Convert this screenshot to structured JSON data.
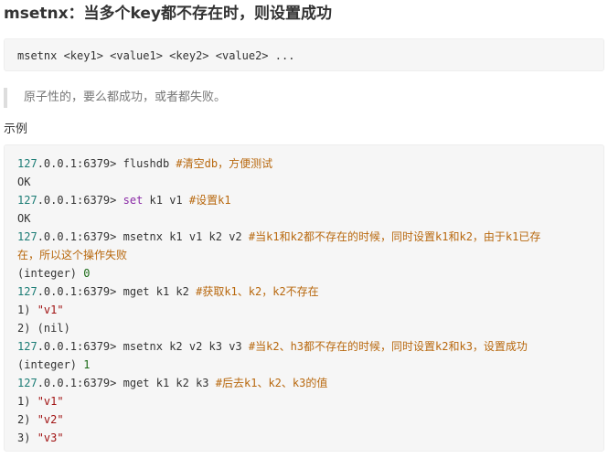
{
  "heading": "msetnx：当多个key都不存在时，则设置成功",
  "syntax": "msetnx <key1> <value1> <key2> <value2> ...",
  "note": "原子性的，要么都成功，或者都失败。",
  "example_label": "示例",
  "colors": {
    "prompt": "#1b7c75",
    "keyword": "#8a2aa6",
    "comment": "#b8680e",
    "string": "#a11313",
    "number": "#1a6a16",
    "code_background": "#f6f6f6"
  },
  "example": {
    "prompt_ip": "127",
    "prompt_rest": ".0.0.1:6379>",
    "lines": [
      {
        "type": "cmd",
        "cmd": " flushdb ",
        "comment": "#清空db，方便测试"
      },
      {
        "type": "out",
        "text": "OK"
      },
      {
        "type": "cmd",
        "kw": "set",
        "cmd": " k1 v1 ",
        "comment": "#设置k1"
      },
      {
        "type": "out",
        "text": "OK"
      },
      {
        "type": "cmd",
        "cmd": " msetnx k1 v1 k2 v2 ",
        "comment": "#当k1和k2都不存在的时候，同时设置k1和k2，由于k1已存"
      },
      {
        "type": "cont",
        "comment": "在，所以这个操作失败"
      },
      {
        "type": "out",
        "text": "(integer) ",
        "num": "0"
      },
      {
        "type": "cmd",
        "cmd": " mget k1 k2 ",
        "comment": "#获取k1、k2，k2不存在"
      },
      {
        "type": "out",
        "text": "1) ",
        "str": "\"v1\""
      },
      {
        "type": "out",
        "text": "2) (nil)"
      },
      {
        "type": "cmd",
        "cmd": " msetnx k2 v2 k3 v3 ",
        "comment": "#当k2、h3都不存在的时候，同时设置k2和k3，设置成功"
      },
      {
        "type": "out",
        "text": "(integer) ",
        "num": "1"
      },
      {
        "type": "cmd",
        "cmd": " mget k1 k2 k3 ",
        "comment": "#后去k1、k2、k3的值"
      },
      {
        "type": "out",
        "text": "1) ",
        "str": "\"v1\""
      },
      {
        "type": "out",
        "text": "2) ",
        "str": "\"v2\""
      },
      {
        "type": "out",
        "text": "3) ",
        "str": "\"v3\""
      }
    ]
  }
}
